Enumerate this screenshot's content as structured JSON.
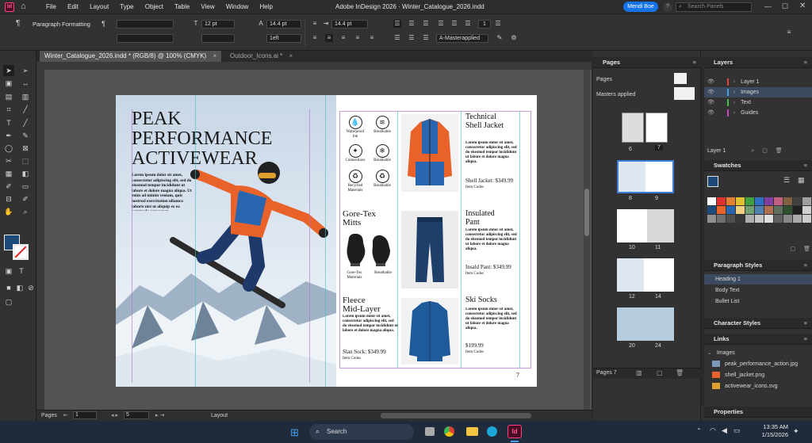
{
  "app": {
    "title": "Adobe InDesign 2026 · Winter_Catalogue_2026.indd",
    "user_button": "Mendi Boe",
    "search_placeholder": "Search Panels"
  },
  "menu": [
    "File",
    "Edit",
    "Layout",
    "Type",
    "Object",
    "Table",
    "View",
    "Window",
    "Help"
  ],
  "control": {
    "mode_label": "Paragraph Formatting",
    "size1": "12 pt",
    "size2": "14.4 pt",
    "leading": "1eft",
    "size3": "14.4 pt",
    "columns": "1",
    "master": "A-Masterapplied"
  },
  "tabs": [
    {
      "label": "Winter_Catalogue_2026.indd * (RGB/8) @ 100% (CMYK)"
    },
    {
      "label": "Outdoor_Icons.ai *"
    }
  ],
  "spread": {
    "hero_title": [
      "PEAK",
      "PERFORMANCE",
      "ACTIVEWEAR"
    ],
    "hero_body": "Lorem ipsum dolor sit amet, consectetur adipiscing elit, sed do eiusmod tempor incididunt ut labore et dolore magna aliqua. Ut enim ad minim veniam, quis nostrud exercitation ullamco laboris nisi ut aliquip ex ea commodo consequat.",
    "icons": [
      {
        "label": "Waterproof Ink",
        "glyph": "💧"
      },
      {
        "label": "Breathable",
        "glyph": "≋"
      },
      {
        "label": "Connections",
        "glyph": "✦"
      },
      {
        "label": "Breathable",
        "glyph": "❄"
      },
      {
        "label": "Recycled Materials",
        "glyph": "♻"
      },
      {
        "label": "Breathable",
        "glyph": "♻"
      }
    ],
    "gore_title": [
      "Gore-Tex",
      "Mitts"
    ],
    "gore_labels": [
      "Gore-Tex Materials",
      "Breathable"
    ],
    "fleece_title": [
      "Fleece",
      "Mid-Layer"
    ],
    "fleece_body": "Lorem ipsum dolor sit amet, consectetur adipiscing elit, sed do eiusmod tempor incididunt ut labore et dolore magna aliqua.",
    "fleece_price": "Slan Sock: $349.99",
    "fleece_codes": "Item Codes",
    "products": [
      {
        "title": [
          "Technical",
          "Shell Jacket"
        ],
        "body": "Lorem ipsum dolor sit amet, consectetur adipiscing elit, sed do eiusmod tempor incididunt ut labore et dolore magna aliqua.",
        "price": "Shell Jacket: $349.99",
        "codes": "Item Codes"
      },
      {
        "title": [
          "Insulated",
          "Pant"
        ],
        "body": "Lorem ipsum dolor sit amet, consectetur adipiscing elit, sed do eiusmod tempor incididunt ut labore et dolore magna aliqua.",
        "price": "Insald Pant: $349.99",
        "codes": "Item Codes"
      },
      {
        "title": [
          "Ski Socks"
        ],
        "body": "Lorem ipsum dolor sit amet, consectetur adipiscing elit, sed do eiusmod tempor incididunt ut labore et dolore magna aliqua.",
        "price": "$199.99",
        "codes": "Item Codes"
      }
    ],
    "page_number": "7"
  },
  "pages_panel": {
    "title": "Pages",
    "pages_label": "Pages",
    "masters_label": "Masters applied",
    "spreads": [
      [
        "6",
        "7"
      ],
      [
        "8",
        "9"
      ],
      [
        "10",
        "11"
      ],
      [
        "12",
        "14"
      ],
      [
        "20",
        "24"
      ]
    ],
    "footer": "Pages 7"
  },
  "layers_panel": {
    "title": "Layers",
    "layers": [
      {
        "name": "Layer 1",
        "color": "#e04a3a"
      },
      {
        "name": "Images",
        "color": "#4aa0e0"
      },
      {
        "name": "Text",
        "color": "#4ac04a"
      },
      {
        "name": "Guides",
        "color": "#c04ac0"
      }
    ],
    "footer": "Layer 1"
  },
  "swatches_panel": {
    "title": "Swatches"
  },
  "paragraph_styles": {
    "title": "Paragraph Styles",
    "items": [
      "Heading 1",
      "Body Text",
      "Bullet List"
    ]
  },
  "character_styles": {
    "title": "Character Styles"
  },
  "links_panel": {
    "title": "Links",
    "items": [
      "Images",
      "peak_performance_action.jpg",
      "shell_jacket.png",
      "activewear_icons.svg"
    ]
  },
  "properties_panel": {
    "title": "Properties"
  },
  "status": {
    "pages_label": "Pages",
    "page1": "1",
    "page2": "5",
    "layout": "Layout"
  },
  "taskbar": {
    "search": "Search",
    "time": "13:35 AM",
    "date": "1/15/2026"
  }
}
